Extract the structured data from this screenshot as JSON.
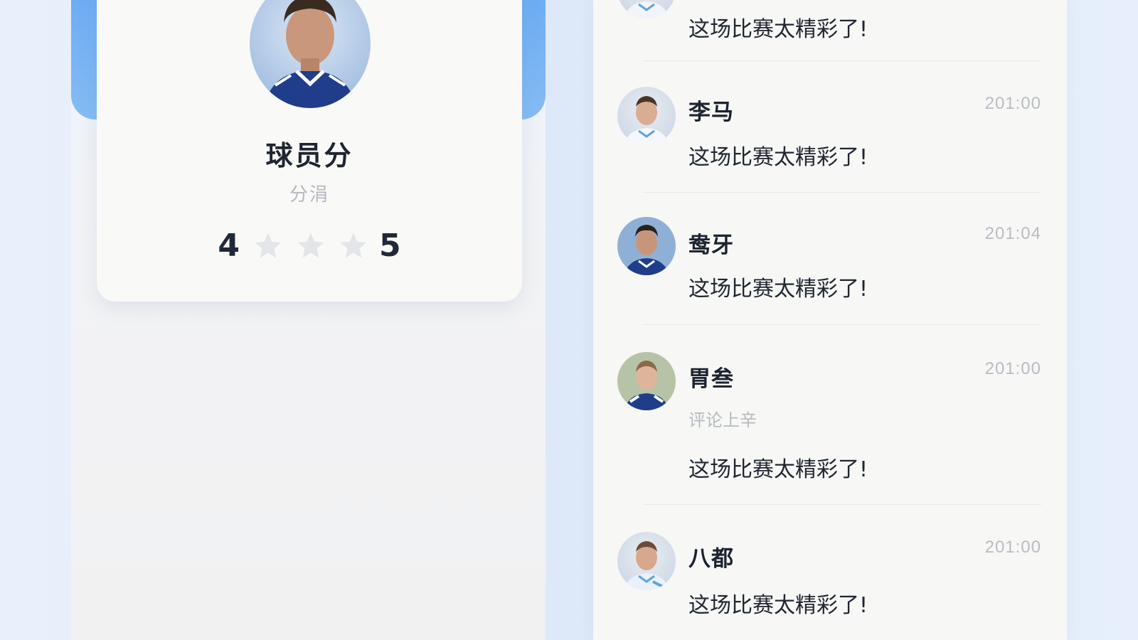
{
  "player": {
    "name": "球员分",
    "subtitle": "分涓",
    "rating": {
      "min_label": "4",
      "max_label": "5",
      "stars_filled": 0,
      "stars_total": 3
    },
    "avatar_icon": "player-portrait"
  },
  "comments": [
    {
      "name": "",
      "time": "",
      "subtitle": "",
      "text": "这场比赛太精彩了!"
    },
    {
      "name": "李马",
      "time": "201:00",
      "subtitle": "",
      "text": "这场比赛太精彩了!"
    },
    {
      "name": "鸯牙",
      "time": "201:04",
      "subtitle": "",
      "text": "这场比赛太精彩了!"
    },
    {
      "name": "胃叁",
      "time": "201:00",
      "subtitle": "评论上辛",
      "text": "这场比赛太精彩了!"
    },
    {
      "name": "八都",
      "time": "201:00",
      "subtitle": "",
      "text": "这场比赛太精彩了!"
    }
  ],
  "colors": {
    "accent_blue": "#6aaaf2",
    "star_empty": "#e3e5e8",
    "text_dark": "#1f2630",
    "text_muted": "#b5bac0"
  }
}
